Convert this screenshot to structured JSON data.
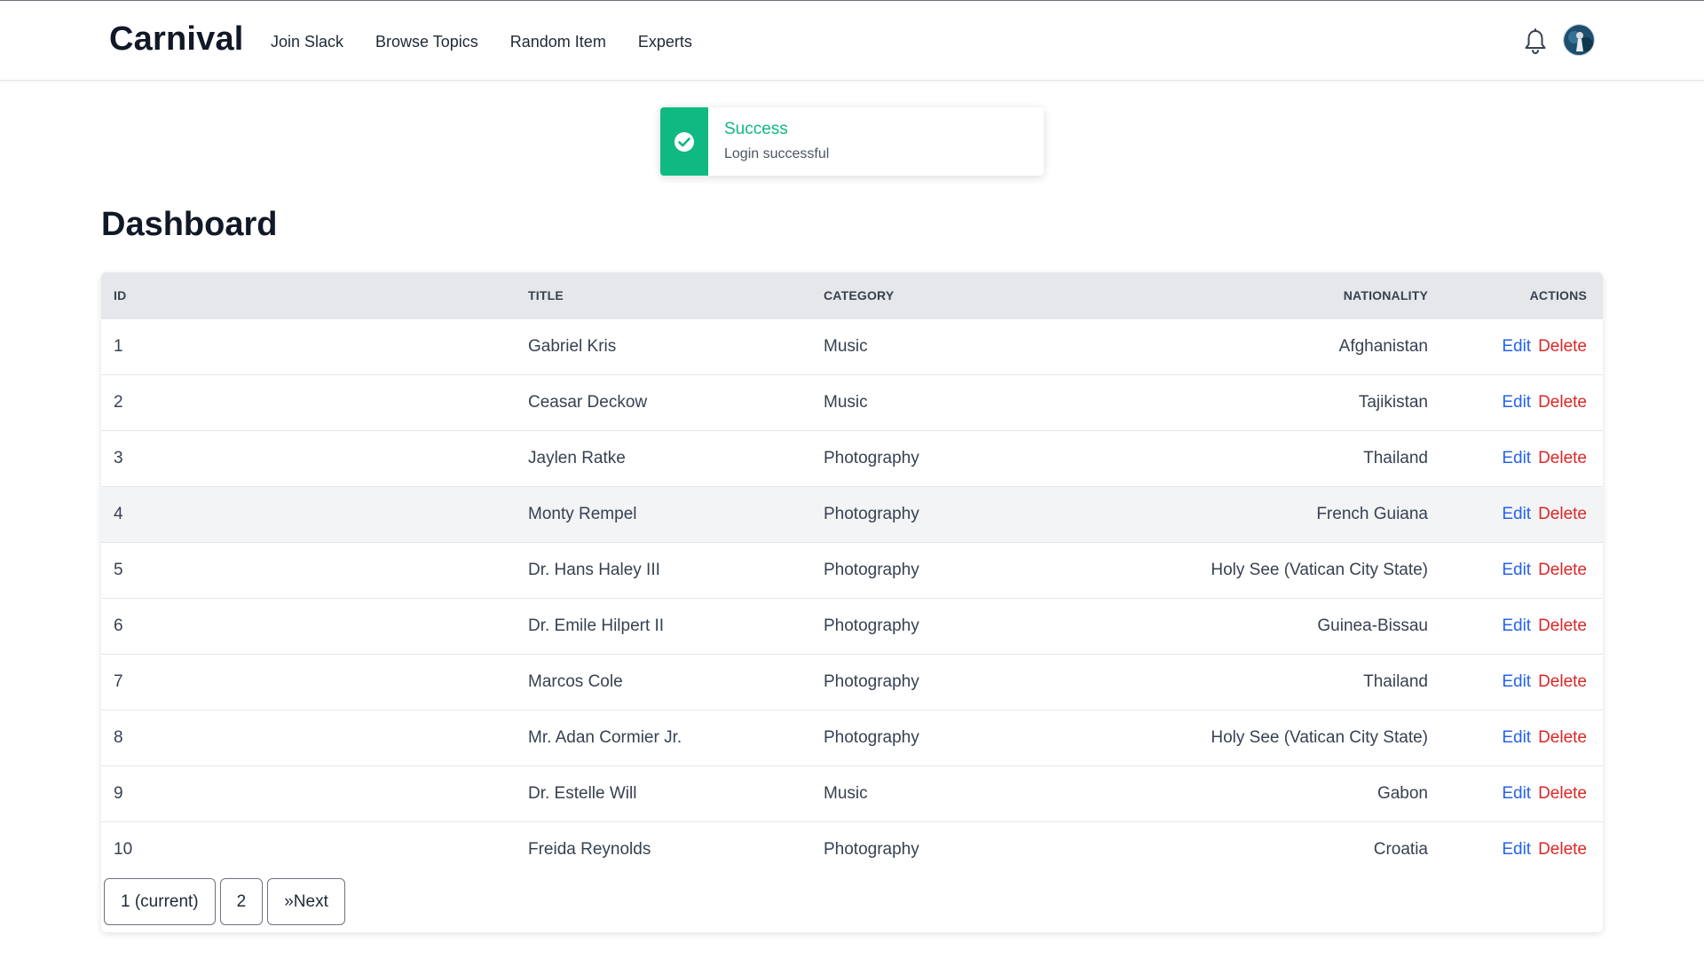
{
  "header": {
    "brand": "Carnival",
    "nav": [
      "Join Slack",
      "Browse Topics",
      "Random Item",
      "Experts"
    ]
  },
  "toast": {
    "title": "Success",
    "message": "Login successful",
    "color": "#10b981"
  },
  "page": {
    "title": "Dashboard"
  },
  "table": {
    "columns": {
      "id": "ID",
      "title": "TITLE",
      "category": "CATEGORY",
      "nationality": "NATIONALITY",
      "actions": "ACTIONS"
    },
    "rows": [
      {
        "id": "1",
        "title": "Gabriel Kris",
        "category": "Music",
        "nationality": "Afghanistan"
      },
      {
        "id": "2",
        "title": "Ceasar Deckow",
        "category": "Music",
        "nationality": "Tajikistan"
      },
      {
        "id": "3",
        "title": "Jaylen Ratke",
        "category": "Photography",
        "nationality": "Thailand"
      },
      {
        "id": "4",
        "title": "Monty Rempel",
        "category": "Photography",
        "nationality": "French Guiana"
      },
      {
        "id": "5",
        "title": "Dr. Hans Haley III",
        "category": "Photography",
        "nationality": "Holy See (Vatican City State)"
      },
      {
        "id": "6",
        "title": "Dr. Emile Hilpert II",
        "category": "Photography",
        "nationality": "Guinea-Bissau"
      },
      {
        "id": "7",
        "title": "Marcos Cole",
        "category": "Photography",
        "nationality": "Thailand"
      },
      {
        "id": "8",
        "title": "Mr. Adan Cormier Jr.",
        "category": "Photography",
        "nationality": "Holy See (Vatican City State)"
      },
      {
        "id": "9",
        "title": "Dr. Estelle Will",
        "category": "Music",
        "nationality": "Gabon"
      },
      {
        "id": "10",
        "title": "Freida Reynolds",
        "category": "Photography",
        "nationality": "Croatia"
      }
    ],
    "edit_label": "Edit",
    "delete_label": "Delete"
  },
  "pagination": {
    "current": "1 (current)",
    "page2": "2",
    "next": "»Next"
  },
  "colors": {
    "edit": "#2563eb",
    "delete": "#dc2626",
    "header_bg": "#e5e7eb"
  }
}
